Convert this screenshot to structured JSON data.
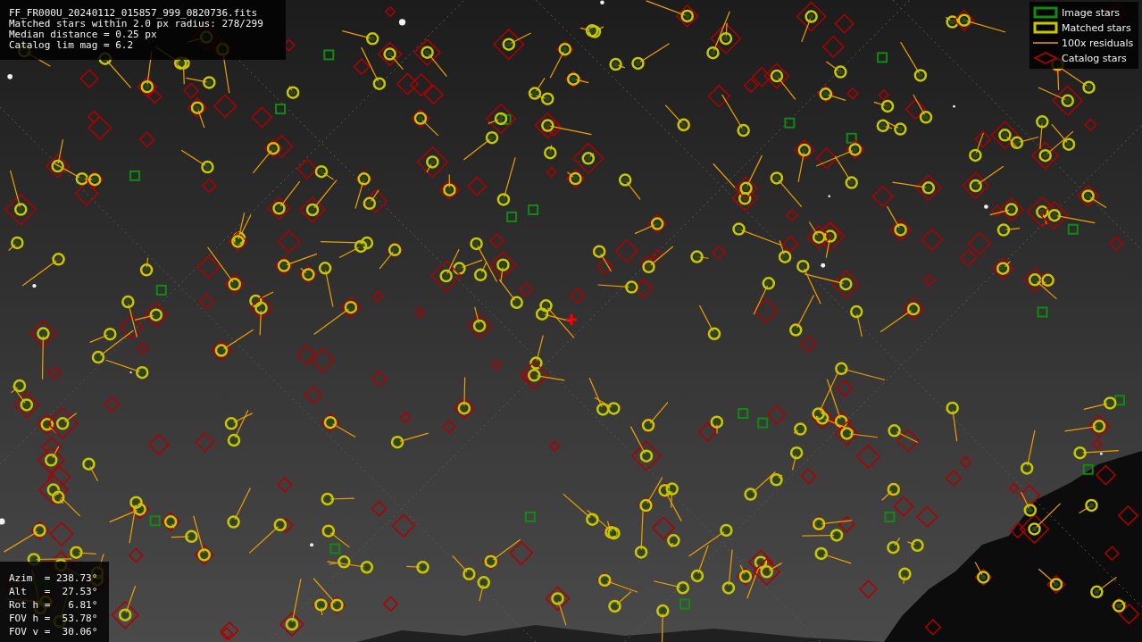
{
  "file_info": {
    "lines": [
      "FF_FR000U_20240112_015857_999_0820736.fits",
      "Matched stars within 2.0 px radius: 278/299",
      "Median distance = 0.25 px",
      "Catalog lim mag = 6.2"
    ]
  },
  "legend": [
    {
      "label": "Image stars",
      "kind": "image"
    },
    {
      "label": "Matched stars",
      "kind": "matched"
    },
    {
      "label": "100x residuals",
      "kind": "residual"
    },
    {
      "label": "Catalog stars",
      "kind": "catalog"
    }
  ],
  "pointing": {
    "lines": [
      "Azim  = 238.73°",
      "Alt   =  27.53°",
      "Rot h =   6.81°",
      "FOV h =  53.78°",
      "FOV v =  30.06°"
    ]
  }
}
